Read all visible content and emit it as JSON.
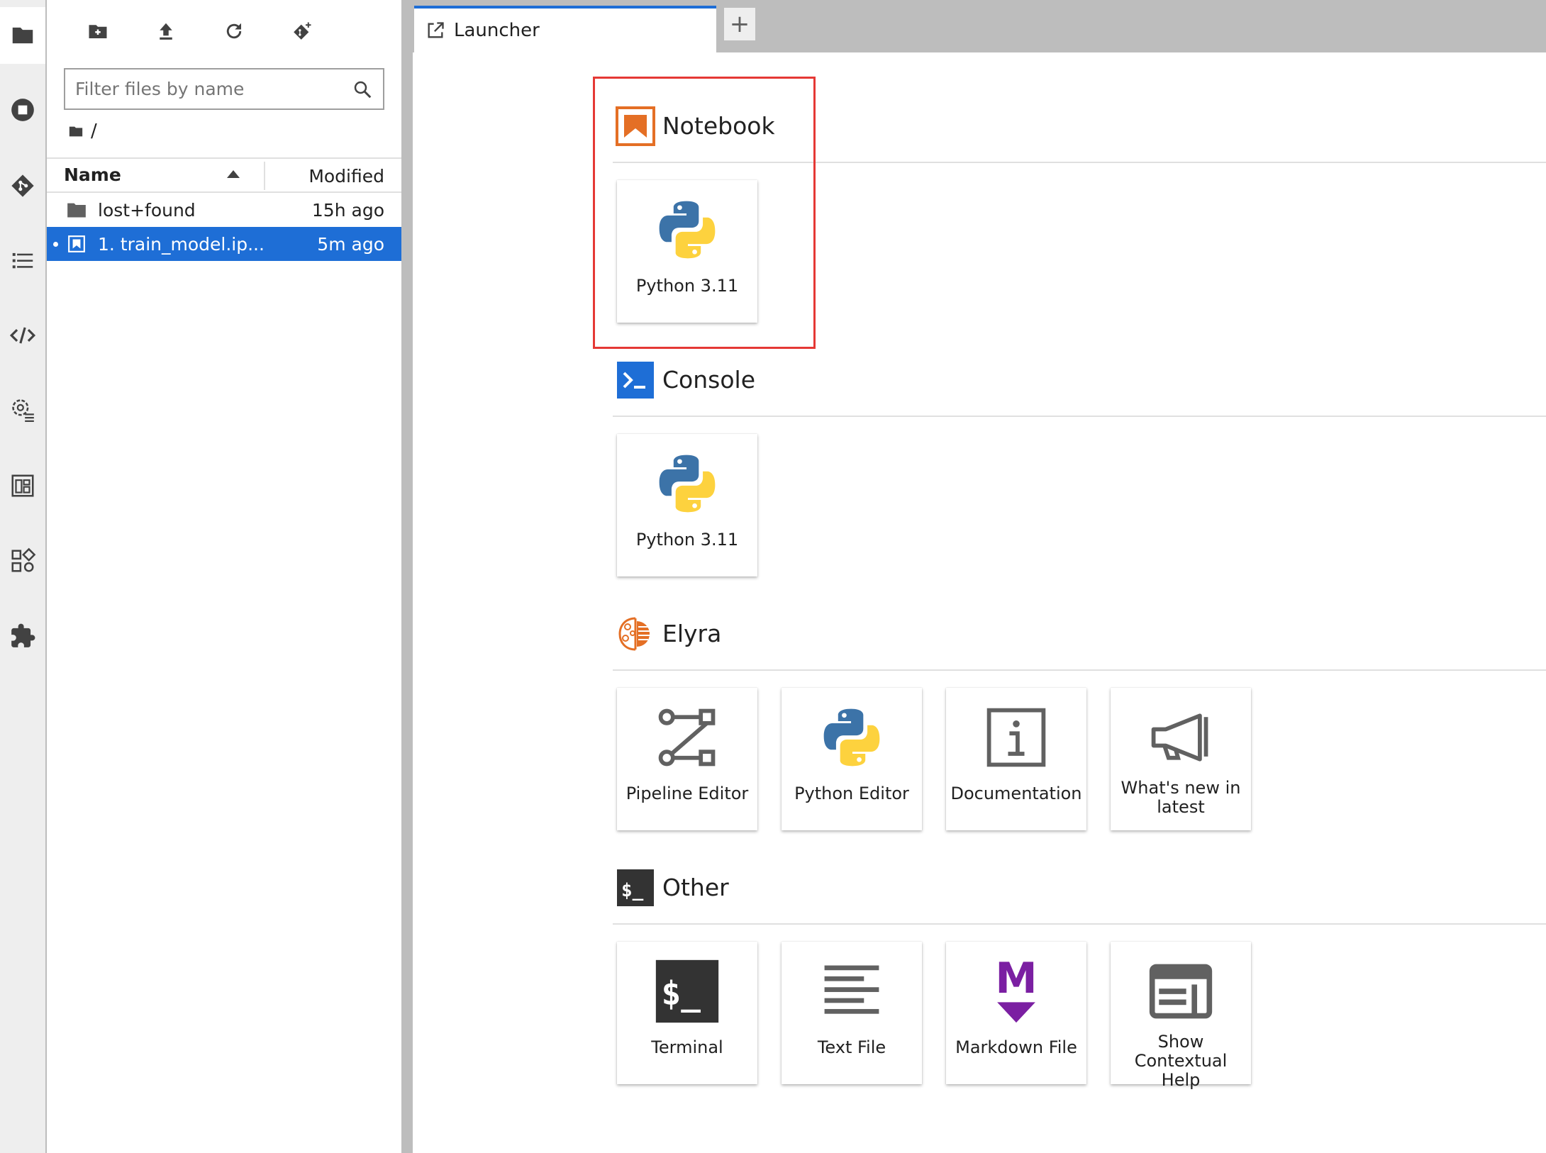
{
  "colors": {
    "accent": "#1e6ed6",
    "notebook_orange": "#e46f25",
    "markdown_purple": "#7b1fa2",
    "highlight_red": "#e53935"
  },
  "activity_bar": {
    "items": [
      {
        "icon": "folder-icon",
        "active": true
      },
      {
        "icon": "running-sessions-icon",
        "active": false
      },
      {
        "icon": "git-icon",
        "active": false
      },
      {
        "icon": "table-of-contents-icon",
        "active": false
      },
      {
        "icon": "code-snippets-icon",
        "active": false
      },
      {
        "icon": "property-inspector-icon",
        "active": false
      },
      {
        "icon": "dashboard-icon",
        "active": false
      },
      {
        "icon": "extension-manager-icon",
        "active": false
      },
      {
        "icon": "puzzle-extension-icon",
        "active": false
      }
    ]
  },
  "file_browser": {
    "toolbar": [
      "new-folder-icon",
      "upload-icon",
      "refresh-icon",
      "git-clone-icon"
    ],
    "filter_placeholder": "Filter files by name",
    "breadcrumb": "/",
    "columns": {
      "name": "Name",
      "modified": "Modified"
    },
    "files": [
      {
        "name": "lost+found",
        "modified": "15h ago",
        "type": "folder",
        "selected": false
      },
      {
        "name": "1. train_model.ip...",
        "modified": "5m ago",
        "type": "notebook",
        "selected": true
      }
    ]
  },
  "tabs": [
    {
      "label": "Launcher",
      "icon": "launcher-icon"
    }
  ],
  "add_tab_label": "+",
  "launcher": {
    "sections": [
      {
        "title": "Notebook",
        "icon": "notebook-icon",
        "cards": [
          {
            "label": "Python 3.11",
            "icon": "python-logo-icon"
          }
        ]
      },
      {
        "title": "Console",
        "icon": "console-icon",
        "cards": [
          {
            "label": "Python 3.11",
            "icon": "python-logo-icon"
          }
        ]
      },
      {
        "title": "Elyra",
        "icon": "elyra-brain-icon",
        "cards": [
          {
            "label": "Pipeline Editor",
            "icon": "pipeline-icon"
          },
          {
            "label": "Python Editor",
            "icon": "python-logo-icon"
          },
          {
            "label": "Documentation",
            "icon": "info-icon"
          },
          {
            "label": "What's new in latest",
            "icon": "megaphone-icon"
          }
        ]
      },
      {
        "title": "Other",
        "icon": "terminal-section-icon",
        "cards": [
          {
            "label": "Terminal",
            "icon": "terminal-icon"
          },
          {
            "label": "Text File",
            "icon": "text-file-icon"
          },
          {
            "label": "Markdown File",
            "icon": "markdown-icon"
          },
          {
            "label": "Show Contextual Help",
            "icon": "contextual-help-icon"
          }
        ]
      }
    ]
  }
}
